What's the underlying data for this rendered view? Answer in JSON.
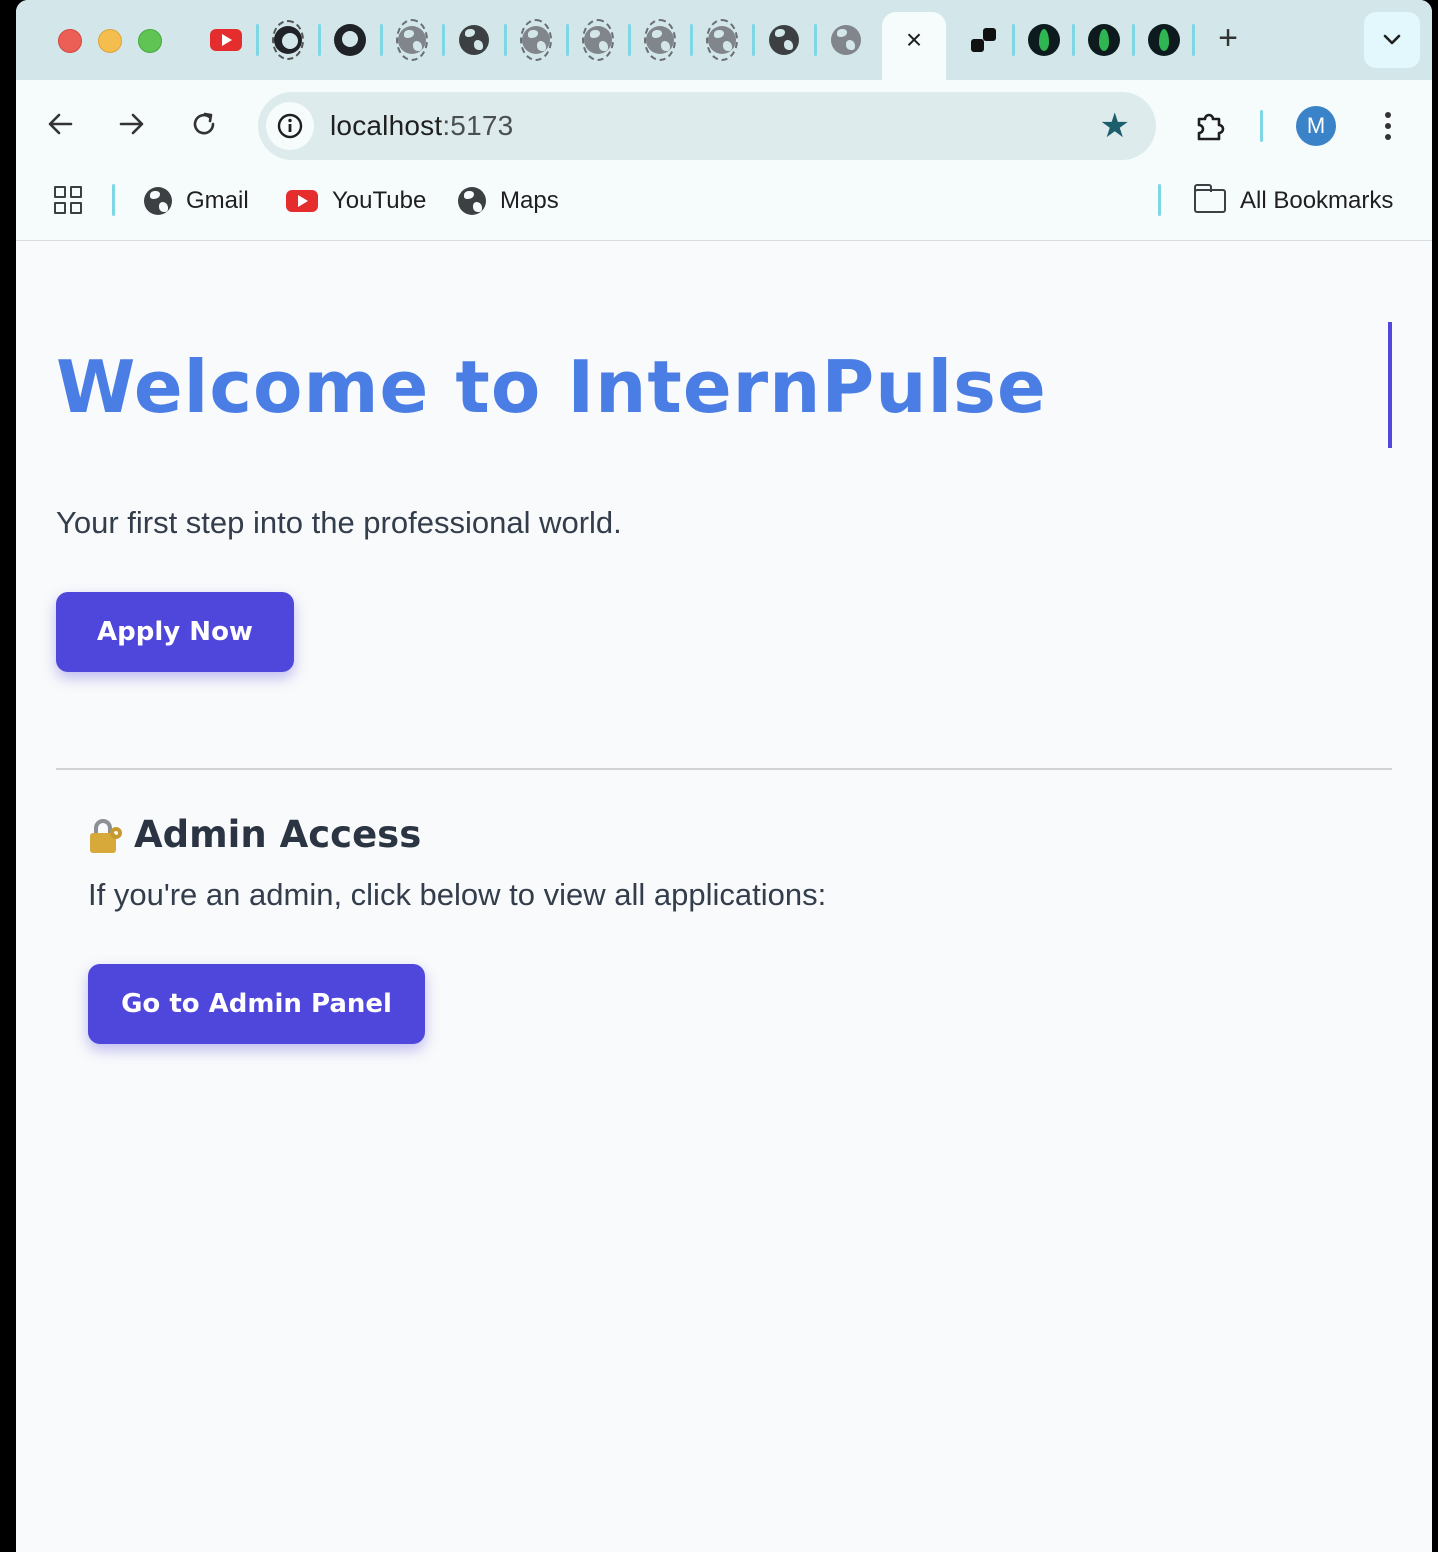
{
  "browser": {
    "tabs": {
      "close_glyph": "×",
      "new_tab_glyph": "+",
      "favicons": [
        "youtube-icon",
        "github-icon",
        "github-icon",
        "globe-icon",
        "globe-icon",
        "globe-icon",
        "globe-icon",
        "globe-icon",
        "globe-icon",
        "globe-icon",
        "globe-icon",
        "link-icon",
        "mongodb-icon",
        "mongodb-icon",
        "mongodb-icon"
      ]
    },
    "address": {
      "host": "localhost",
      "port": ":5173"
    },
    "profile_initial": "M",
    "bookmarks": [
      {
        "label": "Gmail",
        "icon": "globe-icon"
      },
      {
        "label": "YouTube",
        "icon": "youtube-icon"
      },
      {
        "label": "Maps",
        "icon": "globe-icon"
      }
    ],
    "all_bookmarks_label": "All Bookmarks"
  },
  "page": {
    "hero": {
      "title": "Welcome to InternPulse",
      "subtitle": "Your first step into the professional world.",
      "apply_label": "Apply Now"
    },
    "admin": {
      "title": "Admin Access",
      "description": "If you're an admin, click below to view all applications:",
      "button_label": "Go to Admin Panel"
    }
  },
  "colors": {
    "accent": "#4f46dc",
    "title": "#4b7ee5",
    "tab_strip": "#d3e7ea",
    "toolbar": "#f6fbfc"
  }
}
